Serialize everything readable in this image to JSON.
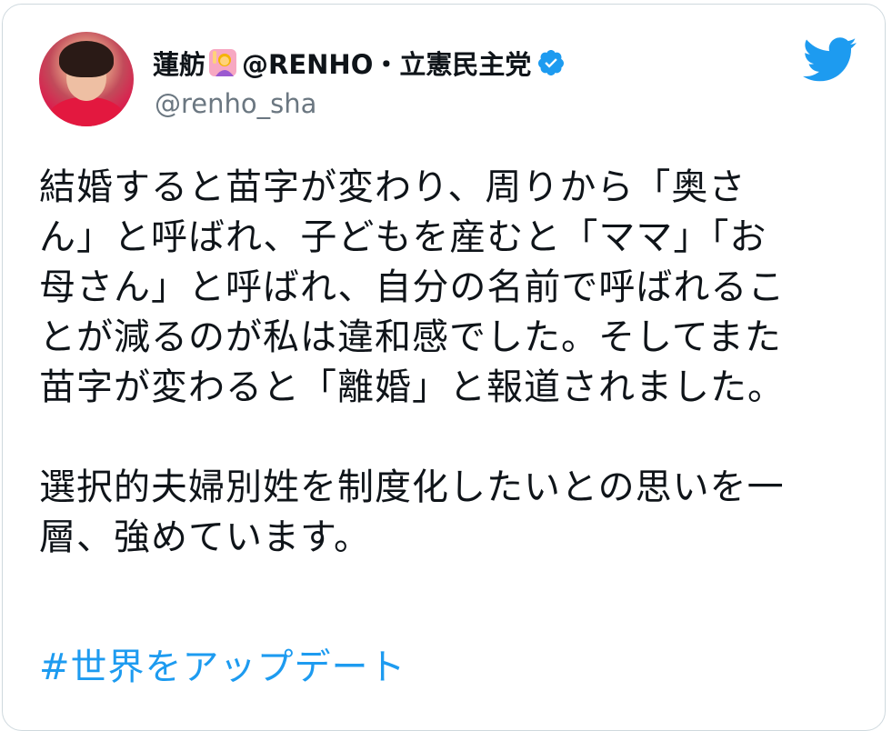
{
  "tweet": {
    "author": {
      "display_name": "蓮舫",
      "display_name_suffix": "@RENHO・立憲民主党",
      "handle": "@renho_sha",
      "verified": true
    },
    "text_paragraph_1": [
      "結婚すると苗字が変わり、周りから「奥さ",
      "ん」と呼ばれ、子どもを産むと「ママ」「お",
      "母さん」と呼ばれ、自分の名前で呼ばれるこ",
      "とが減るのが私は違和感でした。そしてまた",
      "苗字が変わると「離婚」と報道されました。"
    ],
    "text_paragraph_2": [
      "選択的夫婦別姓を制度化したいとの思いを一",
      "層、強めています。"
    ],
    "hashtag": "#世界をアップデート"
  },
  "icons": {
    "emoji": "woman-raising-hand-emoji",
    "verified": "verified-badge-icon",
    "brand": "twitter-bird-icon"
  },
  "colors": {
    "text": "#0f1419",
    "secondary_text": "#6b7781",
    "accent": "#1d9bf0",
    "border": "#cfd9de"
  }
}
